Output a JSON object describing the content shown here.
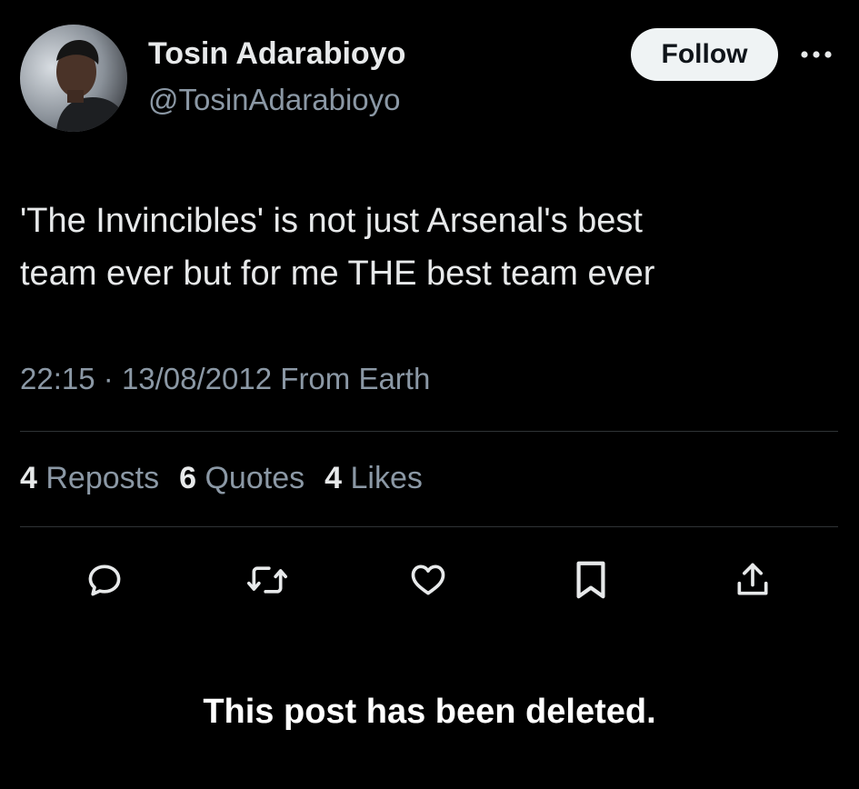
{
  "author": {
    "name": "Tosin Adarabioyo",
    "handle": "@TosinAdarabioyo",
    "avatar_icon": "profile-photo"
  },
  "header": {
    "follow_label": "Follow",
    "more_icon": "more-horizontal-icon"
  },
  "post": {
    "line1": "'The Invincibles' is not just Arsenal's best",
    "line2": "team ever but for me THE best team ever"
  },
  "meta": {
    "time": "22:15",
    "separator": "·",
    "date": "13/08/2012",
    "source": "From Earth"
  },
  "stats": {
    "reposts_count": "4",
    "reposts_label": "Reposts",
    "quotes_count": "6",
    "quotes_label": "Quotes",
    "likes_count": "4",
    "likes_label": "Likes"
  },
  "actions": [
    "reply-icon",
    "repost-icon",
    "like-icon",
    "bookmark-icon",
    "share-icon"
  ],
  "notice": "This post has been deleted.",
  "colors": {
    "background": "#000000",
    "text_primary": "#e7e9ea",
    "text_secondary": "#8b98a5",
    "divider": "#2f3336",
    "follow_bg": "#eff3f4"
  }
}
